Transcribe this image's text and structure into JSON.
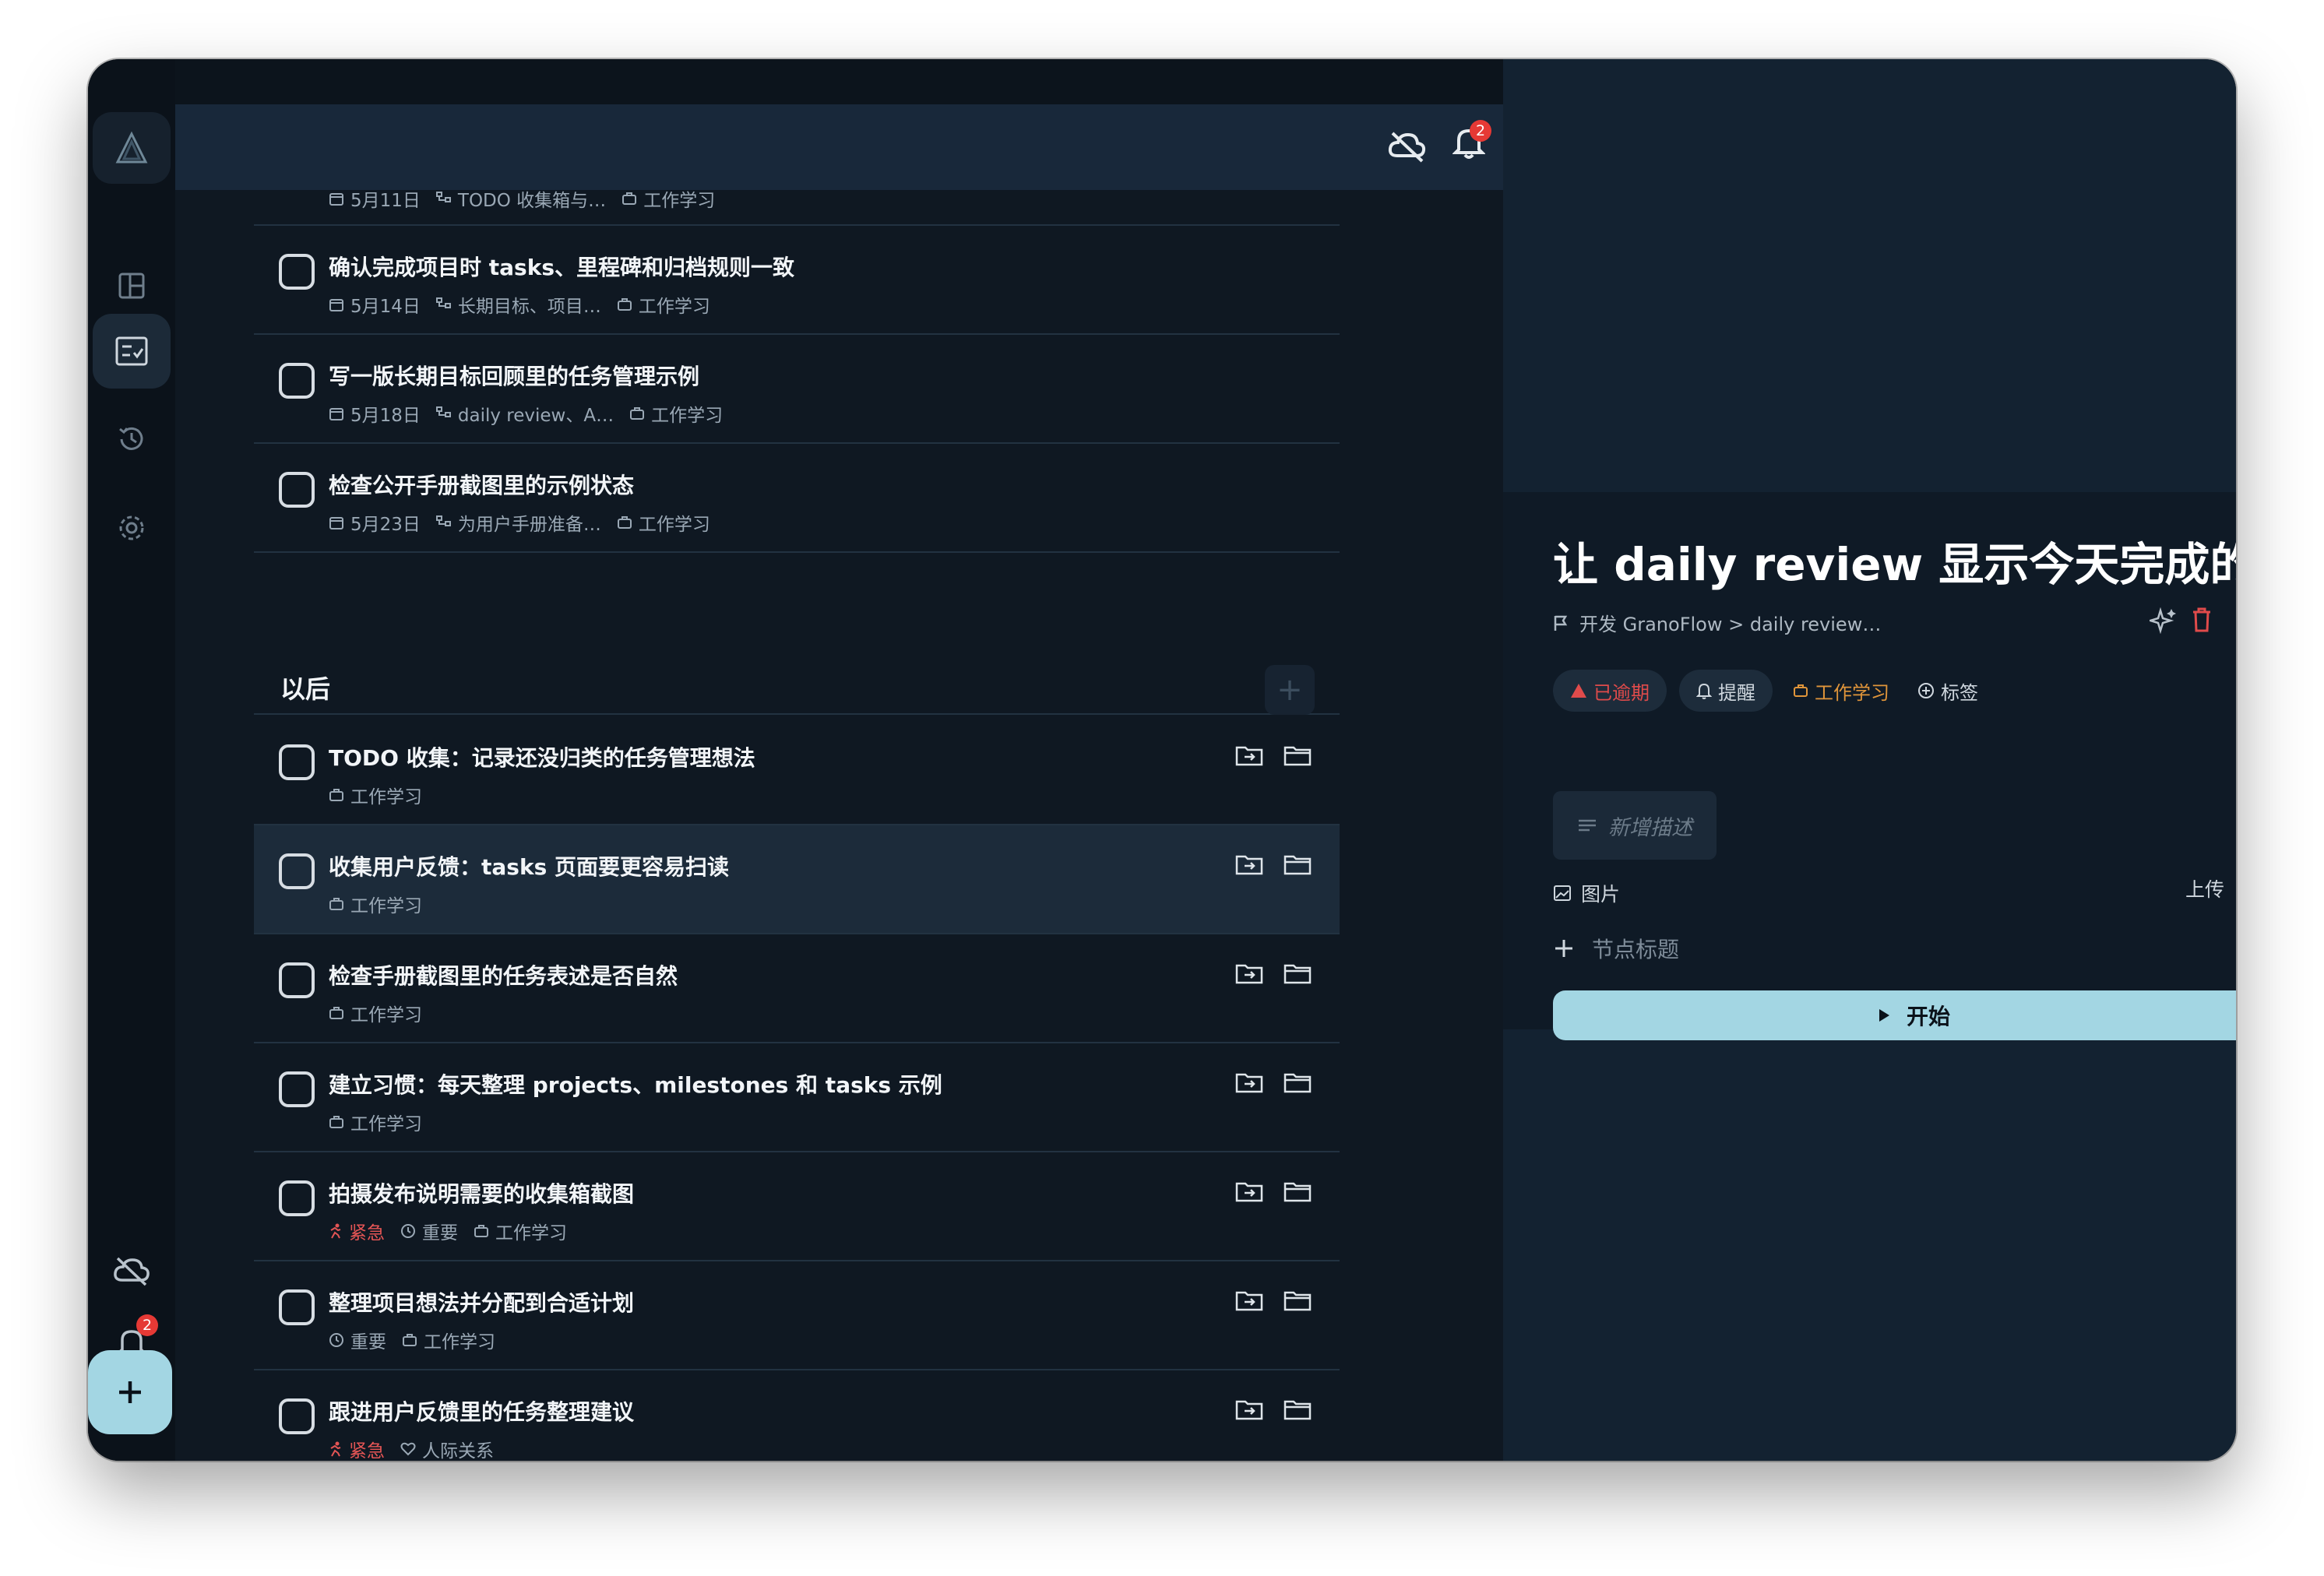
{
  "sidebar": {
    "notification_count": "2"
  },
  "topbar": {
    "notification_count": "2"
  },
  "tasks_top": [
    {
      "title": "",
      "date": "5月11日",
      "project": "TODO 收集箱与…",
      "area": "工作学习"
    },
    {
      "title": "确认完成项目时 tasks、里程碑和归档规则一致",
      "date": "5月14日",
      "project": "长期目标、项目…",
      "area": "工作学习"
    },
    {
      "title": "写一版长期目标回顾里的任务管理示例",
      "date": "5月18日",
      "project": "daily review、A…",
      "area": "工作学习"
    },
    {
      "title": "检查公开手册截图里的示例状态",
      "date": "5月23日",
      "project": "为用户手册准备…",
      "area": "工作学习"
    }
  ],
  "later_section": {
    "title": "以后",
    "add": "+"
  },
  "tasks_later": [
    {
      "title": "TODO 收集：记录还没归类的任务管理想法",
      "area": "工作学习"
    },
    {
      "title": "收集用户反馈：tasks 页面要更容易扫读",
      "area": "工作学习"
    },
    {
      "title": "检查手册截图里的任务表述是否自然",
      "area": "工作学习"
    },
    {
      "title": "建立习惯：每天整理 projects、milestones 和 tasks 示例",
      "area": "工作学习"
    },
    {
      "title": "拍摄发布说明需要的收集箱截图",
      "urgent": "紧急",
      "important": "重要",
      "area": "工作学习"
    },
    {
      "title": "整理项目想法并分配到合适计划",
      "important": "重要",
      "area": "工作学习"
    },
    {
      "title": "跟进用户反馈里的任务整理建议",
      "urgent": "紧急",
      "area": "人际关系"
    }
  ],
  "detail": {
    "title": "让 daily review 显示今天完成的 TOD",
    "breadcrumb": "开发 GranoFlow > daily review…",
    "chip_overdue": "已逾期",
    "chip_remind": "提醒",
    "chip_area": "工作学习",
    "chip_tag": "标签",
    "desc_placeholder": "新增描述",
    "image_label": "图片",
    "upload_label": "上传",
    "node_placeholder": "节点标题",
    "start_label": "开始"
  },
  "colors": {
    "accent": "#a3d6e3",
    "overdue": "#e04b4b",
    "area": "#e0953a",
    "badge": "#e53935"
  }
}
